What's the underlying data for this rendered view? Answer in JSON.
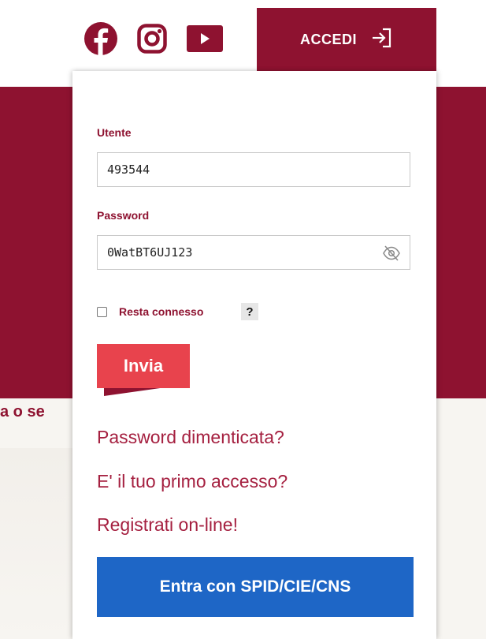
{
  "header": {
    "social_icons": [
      "facebook-icon",
      "instagram-icon",
      "youtube-icon"
    ],
    "login_button_label": "ACCEDI",
    "login_icon": "sign-in-icon"
  },
  "background": {
    "partial_text": "a o se"
  },
  "login_form": {
    "username_label": "Utente",
    "username_value": "493544",
    "password_label": "Password",
    "password_value": "0WatBT6UJ123",
    "password_toggle_icon": "eye-off-icon",
    "remember_me_label": "Resta connesso",
    "remember_me_checked": false,
    "help_label": "?",
    "submit_label": "Invia"
  },
  "links": {
    "forgot_password": "Password dimenticata?",
    "first_access": "E' il tuo primo accesso?",
    "register": "Registrati on-line!"
  },
  "spid_button_label": "Entra con SPID/CIE/CNS",
  "colors": {
    "brand": "#8e1230",
    "accent_red": "#e8434d",
    "link": "#a52040",
    "spid_blue": "#1e66c6"
  }
}
